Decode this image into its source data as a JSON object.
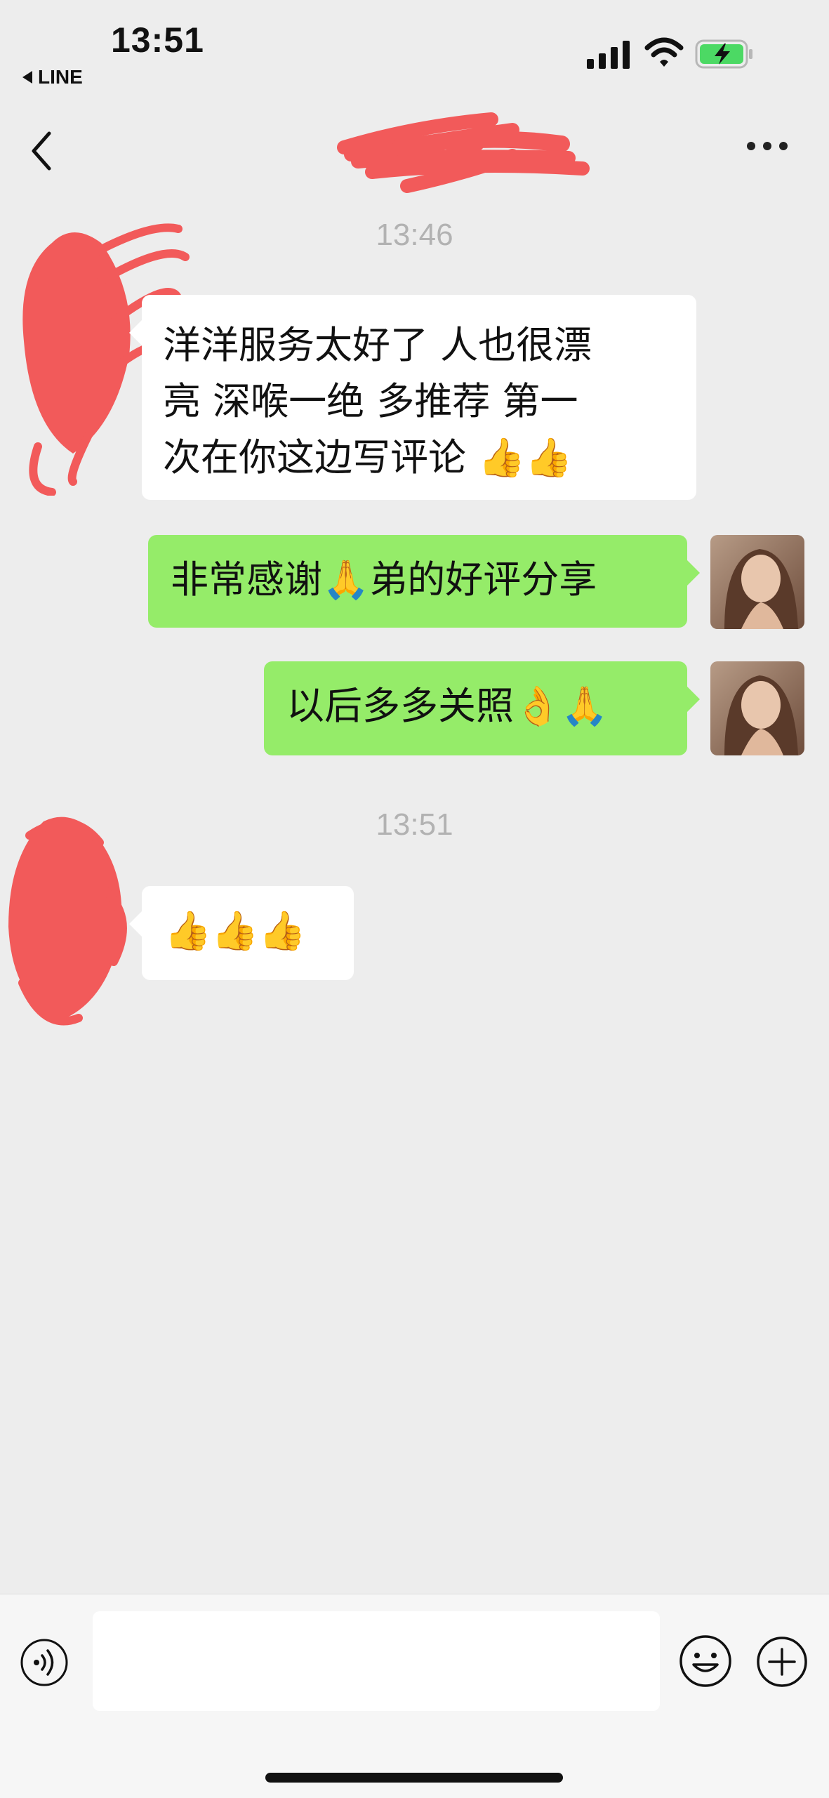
{
  "status_bar": {
    "time": "13:51",
    "back_app": "LINE"
  },
  "chat": {
    "title": "",
    "timestamps": [
      "13:46",
      "13:51"
    ],
    "messages": [
      {
        "side": "in",
        "lines": [
          "洋洋服务太好了 人也很漂",
          "亮  深喉一绝   多推荐  第一",
          "次在你这边写评论  👍👍"
        ]
      },
      {
        "side": "out",
        "text": "非常感谢🙏弟的好评分享"
      },
      {
        "side": "out",
        "text": "以后多多关照👌🙏"
      },
      {
        "side": "in",
        "text": "👍👍👍"
      }
    ]
  },
  "input": {
    "value": "",
    "placeholder": ""
  },
  "icons": {
    "nav_back": "chevron-left-icon",
    "nav_more": "more-dots-icon",
    "voice": "voice-icon",
    "emoji": "emoji-icon",
    "plus": "plus-icon",
    "signal": "signal-icon",
    "wifi": "wifi-icon",
    "battery": "battery-charging-icon"
  },
  "colors": {
    "background": "#ededed",
    "out_bubble": "#95ec69",
    "in_bubble": "#ffffff",
    "redaction": "#f25a5a",
    "battery": "#4cd964"
  }
}
